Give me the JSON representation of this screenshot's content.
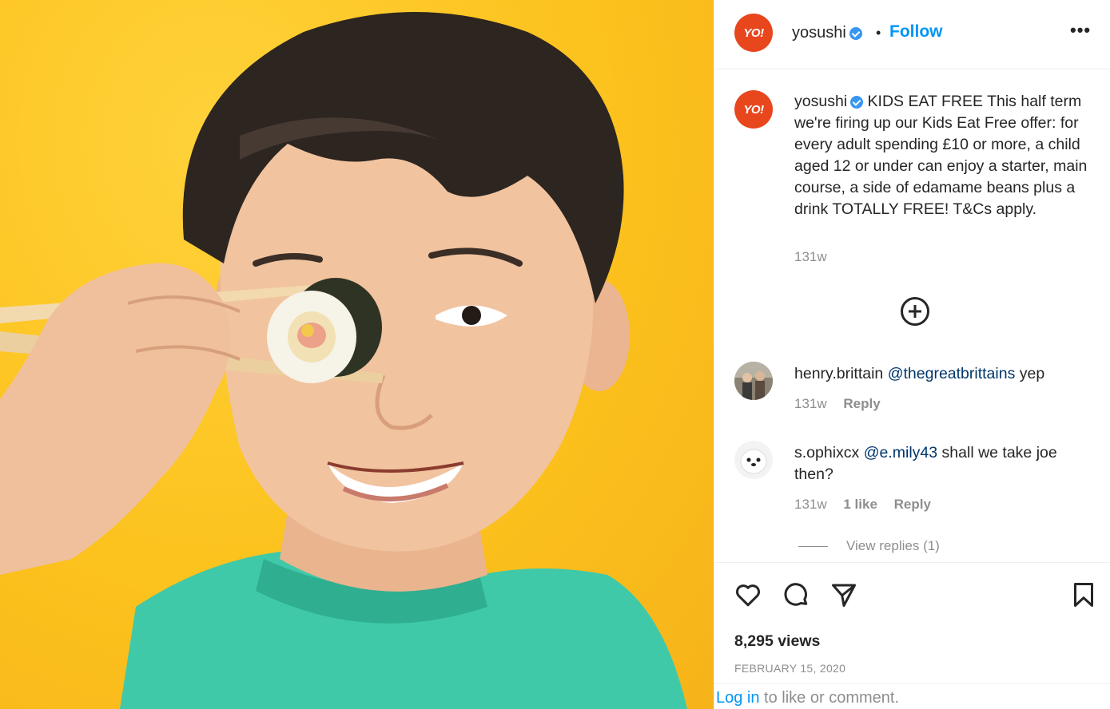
{
  "post": {
    "username": "yosushi",
    "avatar_text": "YO!",
    "dot": "•",
    "follow_label": "Follow",
    "more_label": "•••"
  },
  "caption": {
    "username": "yosushi",
    "text": "KIDS EAT FREE This half term we're firing up our Kids Eat Free offer: for every adult spending £10 or more, a child aged 12 or under can enjoy a starter, main course, a side of edamame beans plus a drink TOTALLY FREE! T&Cs apply.",
    "time": "131w"
  },
  "comments": [
    {
      "username": "henry.brittain",
      "mention": "@thegreatbrittains",
      "text": "yep",
      "time": "131w",
      "reply_label": "Reply"
    },
    {
      "username": "s.ophixcx",
      "mention": "@e.mily43",
      "text": "shall we take joe then?",
      "time": "131w",
      "likes": "1 like",
      "reply_label": "Reply"
    }
  ],
  "view_replies": "View replies (1)",
  "stats": {
    "views": "8,295 views",
    "date": "FEBRUARY 15, 2020"
  },
  "login": {
    "link": "Log in",
    "text": " to like or comment."
  },
  "icons": [
    "heart-icon",
    "comment-icon",
    "share-icon",
    "bookmark-icon",
    "plus-circle-icon",
    "verified-badge-icon"
  ],
  "colors": {
    "brand": "#e8461d",
    "follow": "#0095f6",
    "verified": "#3897f0",
    "photo_background": "#fcc21d",
    "shirt": "#3fc9a9"
  }
}
